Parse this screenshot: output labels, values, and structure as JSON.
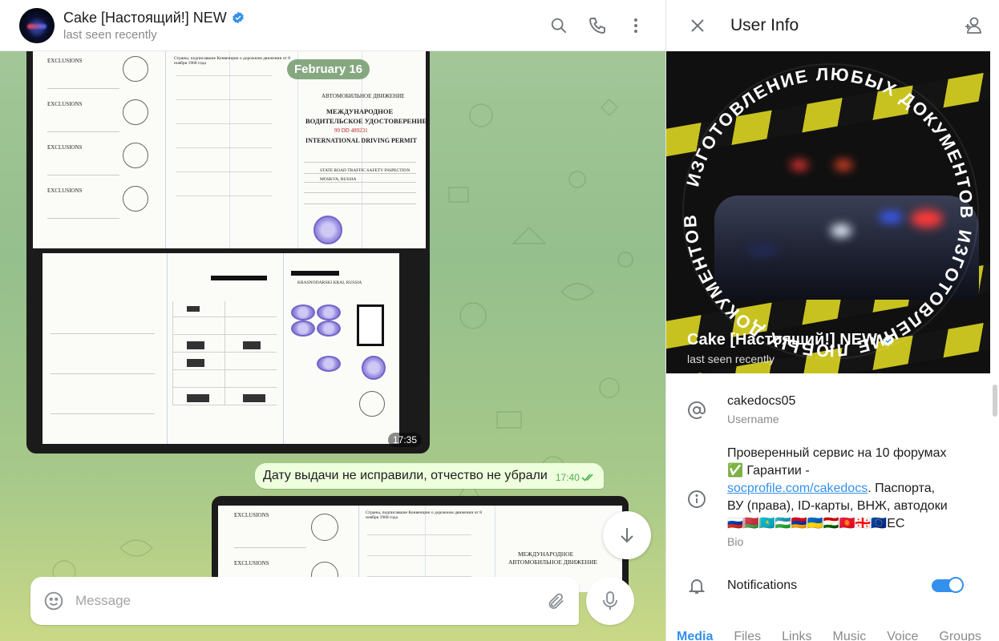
{
  "chat": {
    "title": "Cake [Настоящий!] NEW",
    "status": "last seen recently",
    "date_pill": "February 16",
    "photo1_time": "17:35",
    "text_message": {
      "text": "Дату выдачи не исправили, отчество не убрали",
      "time": "17:40"
    },
    "composer": {
      "placeholder": "Message"
    },
    "icons": {
      "search": "search-icon",
      "call": "phone-icon",
      "menu": "more-vertical-icon",
      "emoji": "emoji-icon",
      "attach": "paperclip-icon",
      "mic": "microphone-icon",
      "scroll": "arrow-down-icon"
    },
    "document": {
      "exclusions": "EXCLUSIONS",
      "titles": [
        "МЕЖДУНАРОДНОЕ",
        "ВОДИТЕЛЬСКОЕ УДОСТОВЕРЕНИЕ",
        "INTERNATIONAL DRIVING PERMIT"
      ],
      "header_ru": "АВТОМОБИЛЬНОЕ ДВИЖЕНИЕ",
      "countries_title": "Страны, подписавшие Конвенцию о дорожном движении от 8 ноября 1968 года",
      "number": "99 DD 489231",
      "issuer": "STATE ROAD TRAFFIC SAFETY INSPECTION",
      "place": "MOSKVA, RUSSIA",
      "region": "KRASNODARSKI KRAI, RUSSIA"
    }
  },
  "info": {
    "title": "User Info",
    "name": "Cake [Настоящий!] NEW",
    "status": "last seen recently",
    "photo_text": "ИЗГОТОВЛЕНИЕ ЛЮБЫХ ДОКУМЕНТОВ",
    "username": {
      "value": "cakedocs05",
      "label": "Username"
    },
    "bio": {
      "line1": "Проверенный сервис на 10 форумах",
      "line2": "✅ Гарантии -",
      "link": "socprofile.com/cakedocs",
      "line3": ". Паспорта,",
      "line4": "ВУ (права), ID-карты, ВНЖ, автодоки",
      "flags": "🇷🇺🇧🇾🇰🇿🇺🇿🇦🇲🇺🇦🇹🇯🇰🇬🇬🇪🇪🇺ЕС",
      "label": "Bio"
    },
    "notifications": {
      "label": "Notifications",
      "enabled": true
    },
    "tabs": [
      "Media",
      "Files",
      "Links",
      "Music",
      "Voice",
      "Groups"
    ],
    "accent": "#3390ec"
  }
}
